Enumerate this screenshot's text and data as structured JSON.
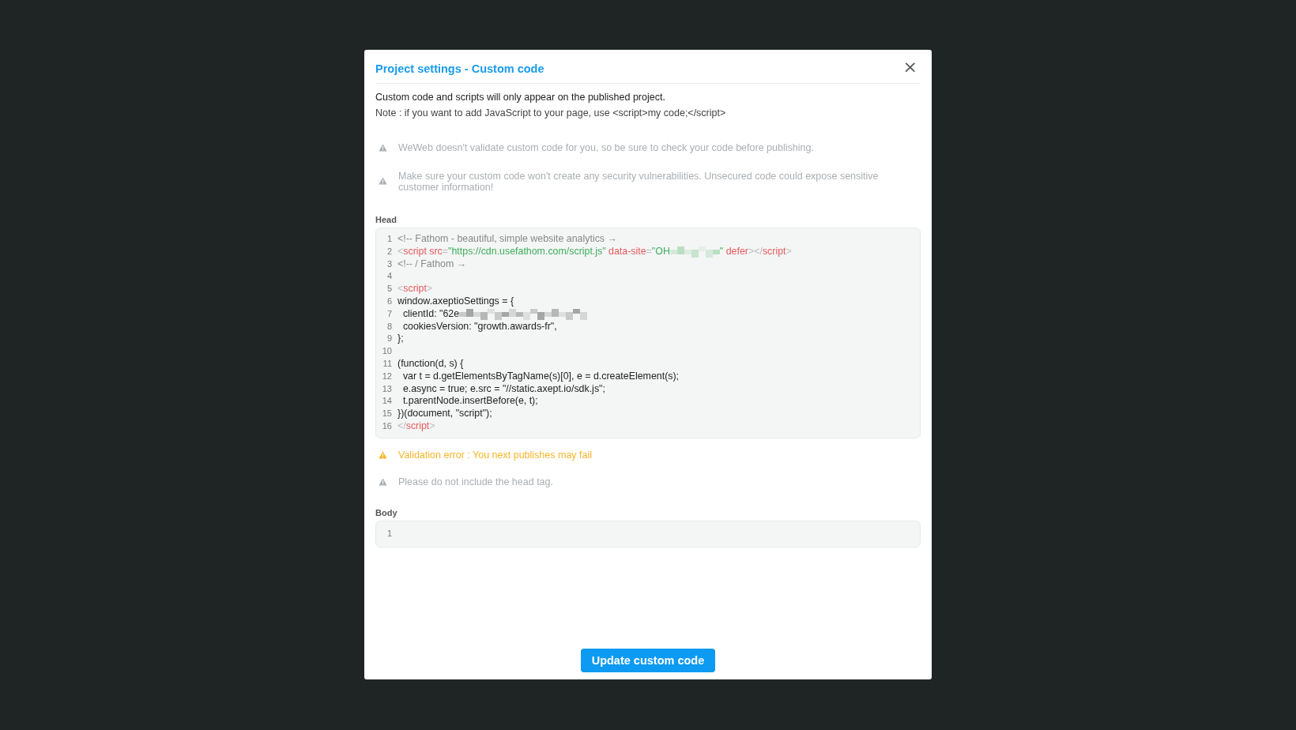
{
  "dialog": {
    "title": "Project settings - Custom code",
    "close": "×",
    "intro": "Custom code and scripts will only appear on the published project.",
    "note": "Note : if you want to add JavaScript to your page, use <script>my code;</script>",
    "notices": [
      {
        "kind": "info",
        "text": "WeWeb doesn't validate custom code for you, so be sure to check your code before publishing."
      },
      {
        "kind": "info",
        "text": "Make sure your custom code won't create any security vulnerabilities. Unsecured code could expose sensitive customer information!"
      }
    ],
    "head": {
      "label": "Head",
      "lines": [
        {
          "number": "1",
          "tokens": [
            {
              "kind": "comment",
              "text": "<!-- Fathom - beautiful, simple website analytics →"
            }
          ]
        },
        {
          "number": "2",
          "tokens": [
            {
              "kind": "punct",
              "text": "<"
            },
            {
              "kind": "tag",
              "text": "script"
            },
            {
              "kind": "attr",
              "text": " src"
            },
            {
              "kind": "punct",
              "text": "="
            },
            {
              "kind": "string",
              "text": "\"https://cdn.usefathom.com/script.js\""
            },
            {
              "kind": "attr",
              "text": " data-site"
            },
            {
              "kind": "punct",
              "text": "="
            },
            {
              "kind": "string",
              "text": "\"OH"
            },
            {
              "kind": "redacted",
              "color": "#b5dcbd"
            },
            {
              "kind": "string",
              "text": "\""
            },
            {
              "kind": "attr",
              "text": " defer"
            },
            {
              "kind": "punct",
              "text": "></"
            },
            {
              "kind": "tag",
              "text": "script"
            },
            {
              "kind": "punct",
              "text": ">"
            }
          ]
        },
        {
          "number": "3",
          "tokens": [
            {
              "kind": "comment",
              "text": "<!-- / Fathom →"
            }
          ]
        },
        {
          "number": "4"
        },
        {
          "number": "5",
          "tokens": [
            {
              "kind": "punct",
              "text": "<"
            },
            {
              "kind": "tag",
              "text": "script"
            },
            {
              "kind": "punct",
              "text": ">"
            }
          ]
        },
        {
          "number": "6",
          "tokens": [
            {
              "kind": "plain",
              "text": "window.axeptioSettings = {"
            }
          ]
        },
        {
          "number": "7",
          "tokens": [
            {
              "kind": "plain",
              "text": "  clientId: \"62e"
            },
            {
              "kind": "redacted",
              "color": "#9c9c9c"
            }
          ]
        },
        {
          "number": "8",
          "tokens": [
            {
              "kind": "plain",
              "text": "  cookiesVersion: \"growth.awards-fr\","
            }
          ]
        },
        {
          "number": "9",
          "tokens": [
            {
              "kind": "plain",
              "text": "};"
            }
          ]
        },
        {
          "number": "10"
        },
        {
          "number": "11",
          "tokens": [
            {
              "kind": "plain",
              "text": "(function(d, s) {"
            }
          ]
        },
        {
          "number": "12",
          "tokens": [
            {
              "kind": "plain",
              "text": "  var t = d.getElementsByTagName(s)[0], e = d.createElement(s);"
            }
          ]
        },
        {
          "number": "13",
          "tokens": [
            {
              "kind": "plain",
              "text": "  e.async = true; e.src = \"//static.axept.io/sdk.js\";"
            }
          ]
        },
        {
          "number": "14",
          "tokens": [
            {
              "kind": "plain",
              "text": "  t.parentNode.insertBefore(e, t);"
            }
          ]
        },
        {
          "number": "15",
          "tokens": [
            {
              "kind": "plain",
              "text": "})(document, \"script\");"
            }
          ]
        },
        {
          "number": "16",
          "tokens": [
            {
              "kind": "punct",
              "text": "</"
            },
            {
              "kind": "tag",
              "text": "script"
            },
            {
              "kind": "punct",
              "text": ">"
            }
          ]
        }
      ]
    },
    "head_notices": [
      {
        "kind": "error",
        "text": "Validation error : You next publishes may fail"
      },
      {
        "kind": "info",
        "text": "Please do not include the head tag."
      }
    ],
    "body": {
      "label": "Body",
      "lines": [
        {
          "number": "1"
        }
      ]
    },
    "button": "Update custom code"
  }
}
